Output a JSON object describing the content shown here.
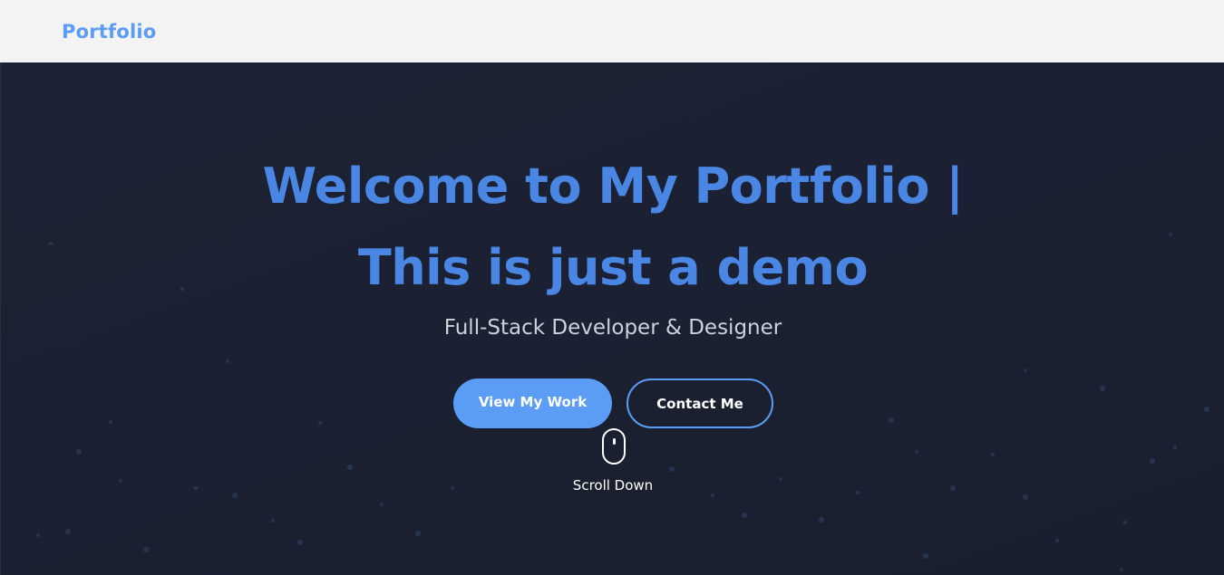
{
  "nav": {
    "brand": "Portfolio"
  },
  "hero": {
    "headline_line1": "Welcome to My Portfolio |",
    "headline_line2": "This is just a demo",
    "subtitle": "Full-Stack Developer & Designer",
    "primary_button": "View My Work",
    "secondary_button": "Contact Me",
    "scroll_label": "Scroll Down"
  },
  "colors": {
    "accent": "#5b9cf5",
    "headline": "#4a86e3",
    "background": "#1b2132",
    "navbar": "#f3f3f3"
  },
  "icons": {
    "scroll_indicator": "mouse-icon"
  }
}
